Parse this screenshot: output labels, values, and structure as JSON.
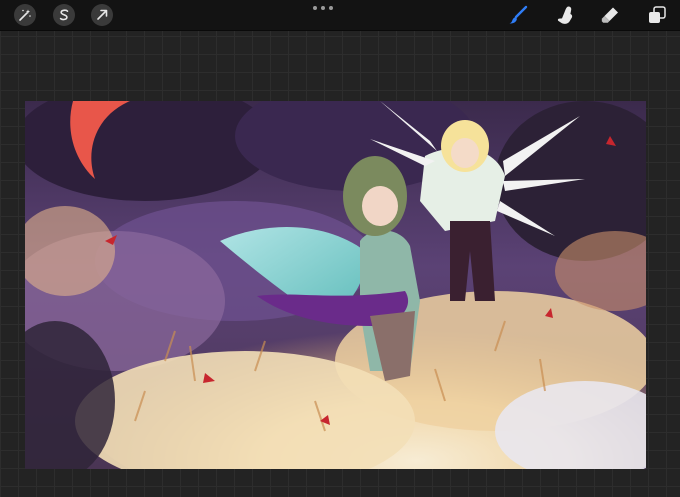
{
  "toolbar": {
    "left_tools": [
      {
        "name": "adjustments-icon"
      },
      {
        "name": "selection-icon"
      },
      {
        "name": "transform-icon"
      }
    ],
    "right_tools": [
      {
        "name": "brush-icon",
        "active": true
      },
      {
        "name": "smudge-icon",
        "active": false
      },
      {
        "name": "eraser-icon",
        "active": false
      },
      {
        "name": "layers-icon",
        "active": false
      }
    ]
  },
  "colors": {
    "accent": "#2f7df6",
    "toolbar_bg": "#131313",
    "workspace_bg": "#232323",
    "tool_icon": "#e8e8e8"
  }
}
